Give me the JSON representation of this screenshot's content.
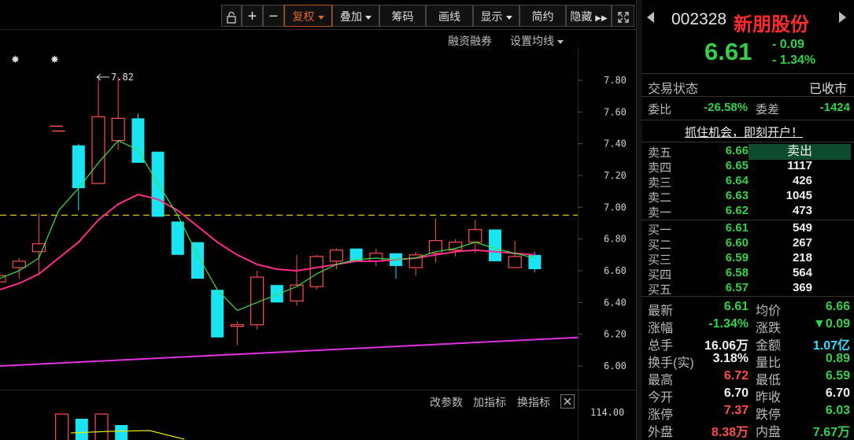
{
  "toolbar": {
    "lock_icon": "lock-icon",
    "plus_icon": "plus-icon",
    "minus_icon": "minus-icon",
    "fuquan": "复权",
    "diejia": "叠加",
    "chouma": "筹码",
    "huaxian": "画线",
    "xianshi": "显示",
    "jianyue": "简约",
    "yincang": "隐藏",
    "fullscreen_icon": "expand-icon"
  },
  "subbar": {
    "rongzi": "融资融券",
    "shezhi": "设置均线"
  },
  "chart_data": {
    "type": "candlestick",
    "y_ticks": [
      "7.80",
      "7.60",
      "7.40",
      "7.20",
      "7.00",
      "6.80",
      "6.60",
      "6.40",
      "6.20",
      "6.00"
    ],
    "ylim": [
      5.97,
      7.85
    ],
    "high_marker": "7.82",
    "dashed_level": 6.95,
    "candles": [
      {
        "o": 6.53,
        "h": 6.64,
        "l": 6.48,
        "c": 6.57,
        "up": true
      },
      {
        "o": 6.62,
        "h": 6.68,
        "l": 6.55,
        "c": 6.66,
        "up": true
      },
      {
        "o": 6.72,
        "h": 6.96,
        "l": 6.57,
        "c": 6.77,
        "up": true
      },
      {
        "o": 7.48,
        "h": 7.48,
        "l": 7.48,
        "c": 7.48,
        "up": true
      },
      {
        "o": 7.12,
        "h": 7.4,
        "l": 6.98,
        "c": 7.39,
        "up": false
      },
      {
        "o": 7.15,
        "h": 7.82,
        "l": 7.15,
        "c": 7.57,
        "up": true
      },
      {
        "o": 7.56,
        "h": 7.82,
        "l": 7.36,
        "c": 7.42,
        "up": true
      },
      {
        "o": 7.56,
        "h": 7.59,
        "l": 7.28,
        "c": 7.28,
        "up": false
      },
      {
        "o": 7.35,
        "h": 7.35,
        "l": 6.94,
        "c": 6.94,
        "up": false
      },
      {
        "o": 6.91,
        "h": 6.91,
        "l": 6.7,
        "c": 6.7,
        "up": false
      },
      {
        "o": 6.78,
        "h": 6.78,
        "l": 6.55,
        "c": 6.55,
        "up": false
      },
      {
        "o": 6.48,
        "h": 6.48,
        "l": 6.18,
        "c": 6.18,
        "up": false
      },
      {
        "o": 6.25,
        "h": 6.28,
        "l": 6.13,
        "c": 6.26,
        "up": true
      },
      {
        "o": 6.26,
        "h": 6.6,
        "l": 6.23,
        "c": 6.56,
        "up": true
      },
      {
        "o": 6.51,
        "h": 6.51,
        "l": 6.4,
        "c": 6.4,
        "up": false
      },
      {
        "o": 6.41,
        "h": 6.7,
        "l": 6.38,
        "c": 6.51,
        "up": true
      },
      {
        "o": 6.5,
        "h": 6.7,
        "l": 6.48,
        "c": 6.69,
        "up": true
      },
      {
        "o": 6.66,
        "h": 6.74,
        "l": 6.61,
        "c": 6.73,
        "up": true
      },
      {
        "o": 6.74,
        "h": 6.74,
        "l": 6.66,
        "c": 6.66,
        "up": false
      },
      {
        "o": 6.66,
        "h": 6.74,
        "l": 6.63,
        "c": 6.71,
        "up": true
      },
      {
        "o": 6.71,
        "h": 6.71,
        "l": 6.55,
        "c": 6.63,
        "up": false
      },
      {
        "o": 6.62,
        "h": 6.72,
        "l": 6.57,
        "c": 6.7,
        "up": true
      },
      {
        "o": 6.71,
        "h": 6.93,
        "l": 6.65,
        "c": 6.79,
        "up": true
      },
      {
        "o": 6.73,
        "h": 6.8,
        "l": 6.69,
        "c": 6.78,
        "up": true
      },
      {
        "o": 6.78,
        "h": 6.92,
        "l": 6.71,
        "c": 6.86,
        "up": true
      },
      {
        "o": 6.86,
        "h": 6.86,
        "l": 6.66,
        "c": 6.66,
        "up": false
      },
      {
        "o": 6.62,
        "h": 6.79,
        "l": 6.62,
        "c": 6.69,
        "up": true
      },
      {
        "o": 6.7,
        "h": 6.72,
        "l": 6.59,
        "c": 6.61,
        "up": false
      }
    ],
    "ma_short": [
      6.55,
      6.6,
      6.68,
      6.98,
      7.12,
      7.28,
      7.42,
      7.36,
      7.15,
      6.95,
      6.7,
      6.48,
      6.35,
      6.4,
      6.45,
      6.5,
      6.58,
      6.64,
      6.67,
      6.68,
      6.67,
      6.68,
      6.72,
      6.74,
      6.78,
      6.74,
      6.71,
      6.68
    ],
    "ma_long": [
      6.48,
      6.52,
      6.58,
      6.68,
      6.78,
      6.92,
      7.02,
      7.08,
      7.05,
      6.98,
      6.88,
      6.78,
      6.7,
      6.64,
      6.61,
      6.6,
      6.62,
      6.64,
      6.66,
      6.66,
      6.67,
      6.68,
      6.7,
      6.72,
      6.73,
      6.72,
      6.71,
      6.7
    ],
    "trend_line": [
      6.0,
      6.18
    ],
    "volume_ylabel": "114.00"
  },
  "indicator_bar": {
    "gaicanshu": "改参数",
    "jiazhibiao": "加指标",
    "huanzhibiao": "换指标",
    "close_icon": "close-icon"
  },
  "stock": {
    "code": "002328",
    "name": "新朋股份",
    "price": "6.61",
    "change": "- 0.09",
    "change_pct": "- 1.34%",
    "nav_left_icon": "caret-left-icon",
    "nav_right_icon": "caret-right-icon"
  },
  "status": {
    "trade_label": "交易状态",
    "trade_value": "已收市",
    "weibi_label": "委比",
    "weibi_value": "-26.58%",
    "weicha_label": "委差",
    "weicha_value": "-1424"
  },
  "promo": "抓住机会，即刻开户！",
  "sell": [
    {
      "label": "卖五",
      "price": "6.66",
      "vol": ""
    },
    {
      "label": "卖四",
      "price": "6.65",
      "vol": "1117"
    },
    {
      "label": "卖三",
      "price": "6.64",
      "vol": "426"
    },
    {
      "label": "卖二",
      "price": "6.63",
      "vol": "1045"
    },
    {
      "label": "卖一",
      "price": "6.62",
      "vol": "473"
    }
  ],
  "sell_button": "卖出",
  "buy": [
    {
      "label": "买一",
      "price": "6.61",
      "vol": "549"
    },
    {
      "label": "买二",
      "price": "6.60",
      "vol": "267"
    },
    {
      "label": "买三",
      "price": "6.59",
      "vol": "218"
    },
    {
      "label": "买四",
      "price": "6.58",
      "vol": "564"
    },
    {
      "label": "买五",
      "price": "6.57",
      "vol": "369"
    }
  ],
  "stats": [
    {
      "l1": "最新",
      "v1": "6.61",
      "c1": "green",
      "l2": "均价",
      "v2": "6.66",
      "c2": "green"
    },
    {
      "l1": "涨幅",
      "v1": "-1.34%",
      "c1": "green",
      "l2": "涨跌",
      "v2": "▼0.09",
      "c2": "green"
    },
    {
      "l1": "总手",
      "v1": "16.06万",
      "c1": "white",
      "l2": "金额",
      "v2": "1.07亿",
      "c2": "cyan"
    },
    {
      "l1": "换手(实)",
      "v1": "3.18%",
      "c1": "white",
      "l2": "量比",
      "v2": "0.89",
      "c2": "green"
    },
    {
      "l1": "最高",
      "v1": "6.72",
      "c1": "red",
      "l2": "最低",
      "v2": "6.59",
      "c2": "green"
    },
    {
      "l1": "今开",
      "v1": "6.70",
      "c1": "white",
      "l2": "昨收",
      "v2": "6.70",
      "c2": "white"
    },
    {
      "l1": "涨停",
      "v1": "7.37",
      "c1": "red",
      "l2": "跌停",
      "v2": "6.03",
      "c2": "green"
    },
    {
      "l1": "外盘",
      "v1": "8.38万",
      "c1": "red",
      "l2": "内盘",
      "v2": "7.67万",
      "c2": "green"
    }
  ],
  "colors": {
    "up": "#ff4d4d",
    "down": "#19e5f2",
    "ma_short": "#3ee04a",
    "ma_long": "#ff2d8a",
    "trend": "#e030e0",
    "dashed": "#d8c400"
  }
}
